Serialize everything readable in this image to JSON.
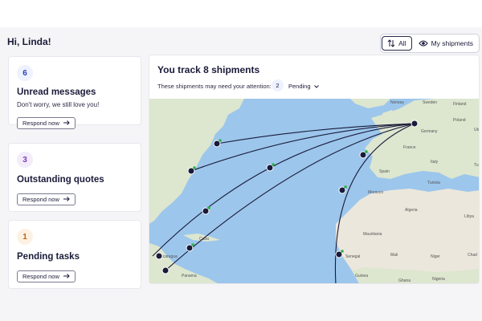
{
  "greeting": "Hi, Linda!",
  "view_toggle": {
    "all_label": "All",
    "mine_label": "My shipments",
    "active": "All"
  },
  "cards": [
    {
      "count": "6",
      "title": "Unread messages",
      "subtitle": "Don't worry, we still love you!",
      "button": "Respond now",
      "badge_color": "#eef2ff",
      "badge_text_color": "#2d3fb8"
    },
    {
      "count": "3",
      "title": "Outstanding quotes",
      "subtitle": "",
      "button": "Respond now",
      "badge_color": "#f3ecfb",
      "badge_text_color": "#7a3db8"
    },
    {
      "count": "1",
      "title": "Pending tasks",
      "subtitle": "",
      "button": "Respond now",
      "badge_color": "#fdf1e3",
      "badge_text_color": "#c2620c"
    }
  ],
  "shipments_panel": {
    "title": "You track 8 shipments",
    "attention_text": "These shipments may need your attention:",
    "attention_count": "2",
    "filter_value": "Pending"
  },
  "map": {
    "labels": [
      "Norway",
      "Sweden",
      "Finland",
      "Poland",
      "Ukraine",
      "Germany",
      "France",
      "Spain",
      "Italy",
      "Turkey",
      "Algeria",
      "Libya",
      "Mali",
      "Niger",
      "Chad",
      "Nigeria",
      "Morocco",
      "Tunisia",
      "Mauritania",
      "Senegal",
      "Guinea",
      "Panama",
      "Nicaragua",
      "Cuba",
      "Ghana"
    ],
    "colors": {
      "ocean": "#9cc6ec",
      "land": "#dde6cf",
      "desert": "#ece7dc",
      "route": "#1a1a3a",
      "marker": "#1a1a3a",
      "status_dot": "#2fb14b"
    }
  }
}
